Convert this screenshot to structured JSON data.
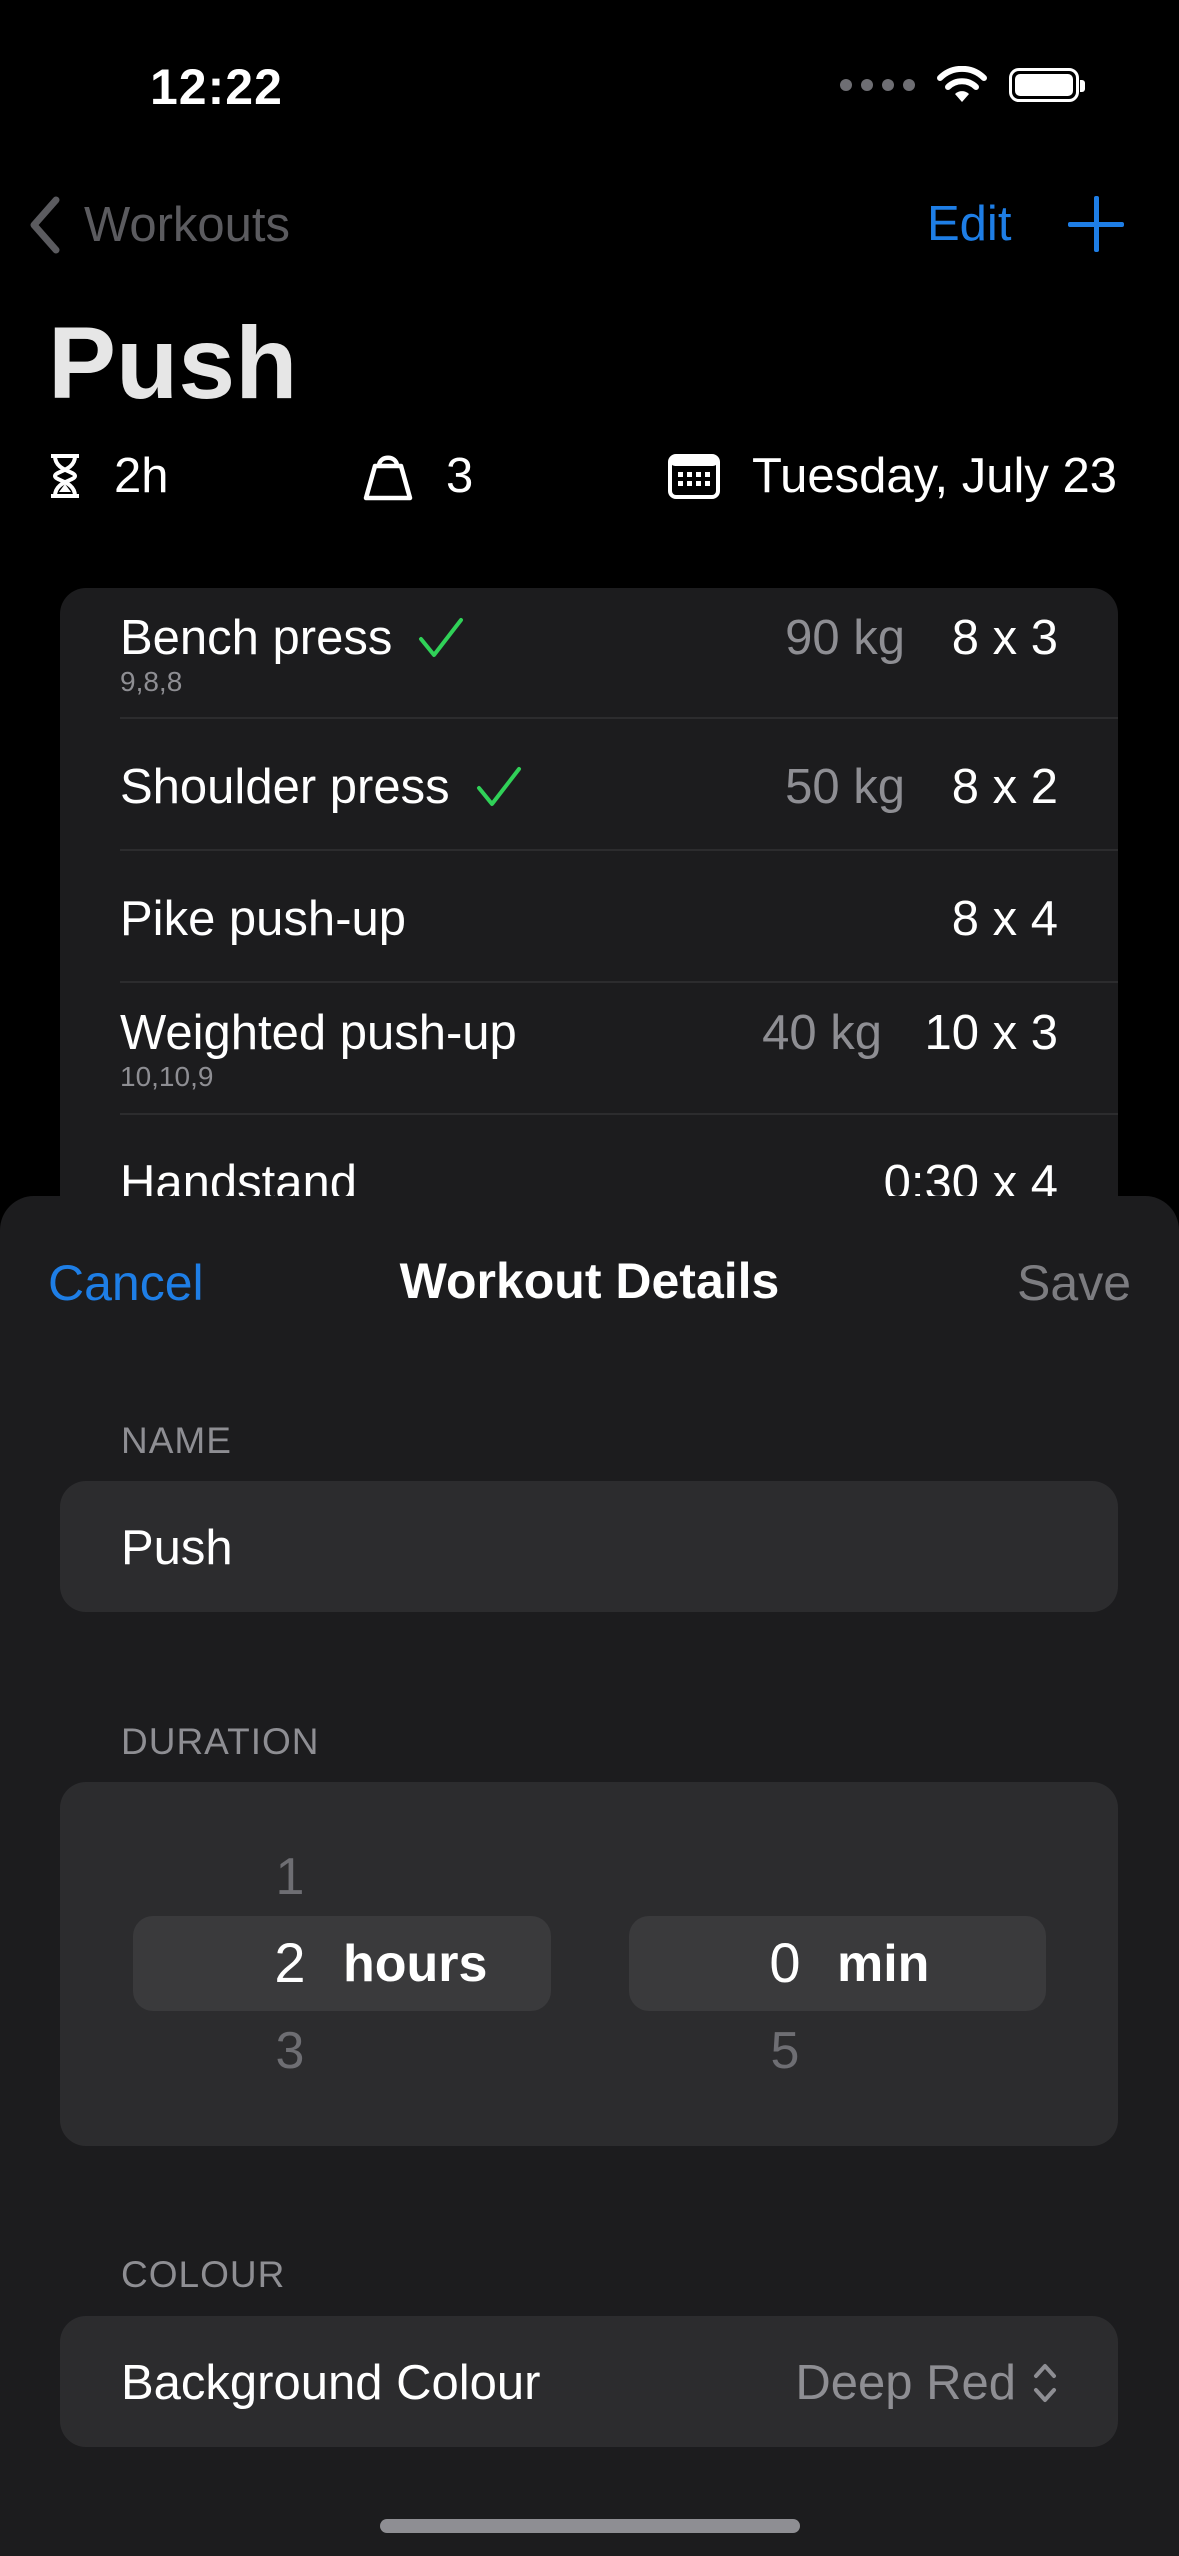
{
  "status_bar": {
    "time": "12:22"
  },
  "nav": {
    "back_label": "Workouts",
    "edit_label": "Edit"
  },
  "workout": {
    "title": "Push",
    "duration": "2h",
    "exercise_count": "3",
    "date": "Tuesday, July 23"
  },
  "exercises": [
    {
      "name": "Bench press",
      "done": true,
      "sets_detail": "9,8,8",
      "weight": "90 kg",
      "reps": "8 x 3"
    },
    {
      "name": "Shoulder press",
      "done": true,
      "sets_detail": "",
      "weight": "50 kg",
      "reps": "8 x 2"
    },
    {
      "name": "Pike push-up",
      "done": false,
      "sets_detail": "",
      "weight": "",
      "reps": "8 x 4"
    },
    {
      "name": "Weighted push-up",
      "done": false,
      "sets_detail": "10,10,9",
      "weight": "40 kg",
      "reps": "10 x 3"
    },
    {
      "name": "Handstand",
      "done": false,
      "sets_detail": "",
      "weight": "",
      "reps": "0:30 x 4"
    }
  ],
  "sheet": {
    "cancel_label": "Cancel",
    "title": "Workout Details",
    "save_label": "Save",
    "name_section": "NAME",
    "name_value": "Push",
    "duration_section": "DURATION",
    "hours_picker": {
      "prev": "1",
      "selected": "2",
      "next": "3",
      "unit": "hours"
    },
    "minutes_picker": {
      "selected": "0",
      "next": "5",
      "unit": "min"
    },
    "colour_section": "COLOUR",
    "background_colour_label": "Background Colour",
    "background_colour_value": "Deep Red"
  },
  "colors": {
    "accent": "#1e7ee6",
    "check": "#30d158",
    "background": "#000000",
    "sheet": "#1c1c1e"
  },
  "icons": [
    "chevron-left-icon",
    "plus-icon",
    "hourglass-icon",
    "kettlebell-icon",
    "calendar-icon",
    "checkmark-icon",
    "chevron-up-down-icon",
    "wifi-icon",
    "battery-icon"
  ]
}
